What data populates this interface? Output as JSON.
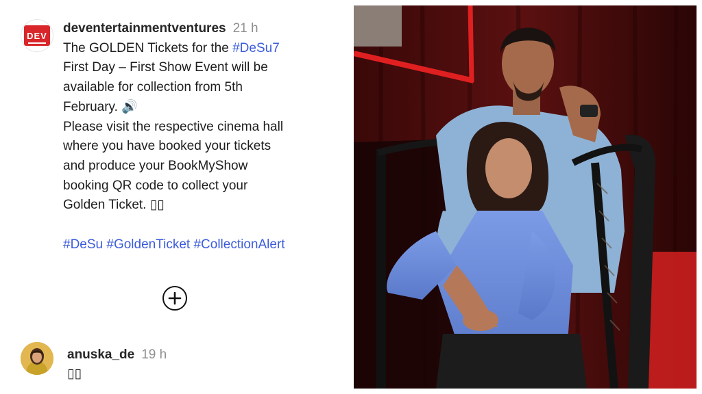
{
  "post": {
    "username": "deventertainmentventures",
    "time": "21 h",
    "logo_text": "DEV",
    "caption_lines": [
      {
        "text": "The GOLDEN Tickets for the ",
        "tag": "#DeSu7"
      },
      {
        "text": "First Day – First Show Event will be"
      },
      {
        "text": "available for collection from 5th"
      },
      {
        "text": "February. 🔊"
      },
      {
        "text": "Please visit the respective cinema hall"
      },
      {
        "text": "where you have booked your tickets"
      },
      {
        "text": "and produce your BookMyShow"
      },
      {
        "text": "booking QR code to collect your"
      },
      {
        "text": "Golden Ticket. ▯▯"
      }
    ],
    "hashtags": [
      "#DeSu",
      "#GoldenTicket",
      "#CollectionAlert"
    ]
  },
  "actions": {
    "expand_icon": "plus-circle-icon"
  },
  "comment": {
    "username": "anuska_de",
    "time": "19 h",
    "text": "▯▯"
  },
  "colors": {
    "hashtag": "#3b5bdb",
    "muted": "#8e8e8e",
    "logo_red": "#d8262a"
  }
}
